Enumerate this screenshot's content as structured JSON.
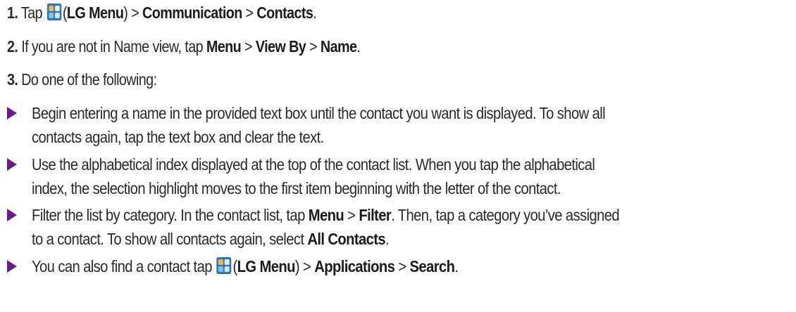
{
  "steps": [
    {
      "num": "1.",
      "t1": "Tap",
      "paren_open": "(",
      "lg_menu": "LG Menu",
      "paren_close": ")",
      "sep1": " > ",
      "b2": "Communication",
      "sep2": " > ",
      "b3": "Contacts",
      "end": "."
    },
    {
      "num": "2.",
      "t1": " If you are not in Name view, tap ",
      "b1": "Menu",
      "sep1": " > ",
      "b2": "View By",
      "sep2": " > ",
      "b3": "Name",
      "end": "."
    },
    {
      "num": "3.",
      "t1": " Do one of the following:"
    }
  ],
  "bullets": [
    {
      "line1": "Begin entering a name in the provided text box until the contact you want is displayed. To show all",
      "line2": "contacts again, tap the text box and clear the text."
    },
    {
      "line1": "Use the alphabetical index displayed at the top of the contact list. When you tap the alphabetical",
      "line2": "index, the selection highlight moves to the first item beginning with the letter of the contact."
    },
    {
      "line1_a": "Filter the list by category. In the contact list, tap ",
      "line1_b": "Menu",
      "line1_sep": " > ",
      "line1_c": "Filter",
      "line1_d": ". Then, tap a category you’ve assigned",
      "line2_a": "to a contact. To show all contacts again, select ",
      "line2_b": "All Contacts",
      "line2_c": "."
    },
    {
      "t1": "You can also find a contact tap ",
      "paren_open": "(",
      "lg_menu": "LG Menu",
      "paren_close": ")",
      "sep1": " > ",
      "b2": "Applications",
      "sep2": " > ",
      "b3": "Search",
      "end": "."
    }
  ],
  "colors": {
    "bullet": "#6a1b8a",
    "text": "#2a2a2a",
    "icon_blue": "#3b83c9"
  },
  "icons": {
    "lg_menu": "lg-menu-icon",
    "bullet": "triangle-bullet-icon"
  }
}
